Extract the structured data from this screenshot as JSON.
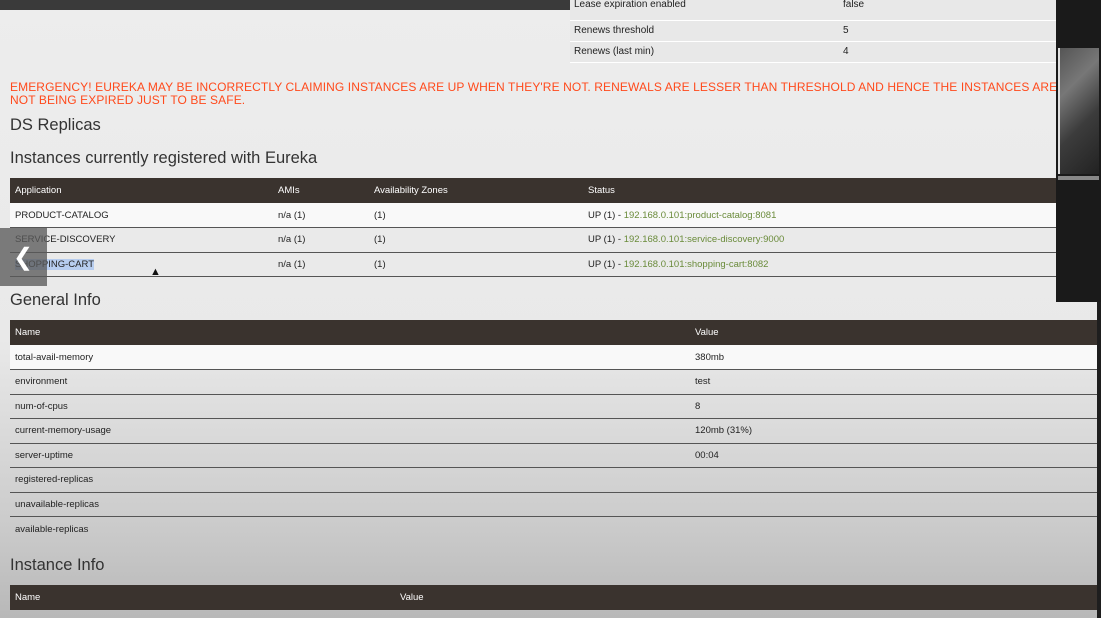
{
  "lease_table": [
    {
      "name": "Lease expiration enabled",
      "value": "false"
    },
    {
      "name": "Renews threshold",
      "value": "5"
    },
    {
      "name": "Renews (last min)",
      "value": "4"
    }
  ],
  "emergency_message": "EMERGENCY! EUREKA MAY BE INCORRECTLY CLAIMING INSTANCES ARE UP WHEN THEY'RE NOT. RENEWALS ARE LESSER THAN THRESHOLD AND HENCE THE INSTANCES ARE NOT BEING EXPIRED JUST TO BE SAFE.",
  "headings": {
    "ds_replicas": "DS Replicas",
    "instances": "Instances currently registered with Eureka",
    "general_info": "General Info",
    "instance_info": "Instance Info"
  },
  "instances_table": {
    "headers": [
      "Application",
      "AMIs",
      "Availability Zones",
      "Status"
    ],
    "rows": [
      {
        "application": "PRODUCT-CATALOG",
        "amis": "n/a (1)",
        "zones": "(1)",
        "status": "UP (1) - ",
        "link": "192.168.0.101:product-catalog:8081"
      },
      {
        "application": "SERVICE-DISCOVERY",
        "amis": "n/a (1)",
        "zones": "(1)",
        "status": "UP (1) - ",
        "link": "192.168.0.101:service-discovery:9000"
      },
      {
        "application": "SHOPPING-CART",
        "amis": "n/a (1)",
        "zones": "(1)",
        "status": "UP (1) - ",
        "link": "192.168.0.101:shopping-cart:8082"
      }
    ]
  },
  "general_info_table": {
    "headers": [
      "Name",
      "Value"
    ],
    "rows": [
      {
        "name": "total-avail-memory",
        "value": "380mb"
      },
      {
        "name": "environment",
        "value": "test"
      },
      {
        "name": "num-of-cpus",
        "value": "8"
      },
      {
        "name": "current-memory-usage",
        "value": "120mb (31%)"
      },
      {
        "name": "server-uptime",
        "value": "00:04"
      },
      {
        "name": "registered-replicas",
        "value": ""
      },
      {
        "name": "unavailable-replicas",
        "value": ""
      },
      {
        "name": "available-replicas",
        "value": ""
      }
    ]
  },
  "instance_info_table": {
    "headers": [
      "Name",
      "Value"
    ]
  },
  "colors": {
    "emergency": "#ff4a1c",
    "header_bg": "#3a332e",
    "link": "#6a8b3a"
  },
  "icons": {
    "nav_back": "chevron-left-icon"
  }
}
